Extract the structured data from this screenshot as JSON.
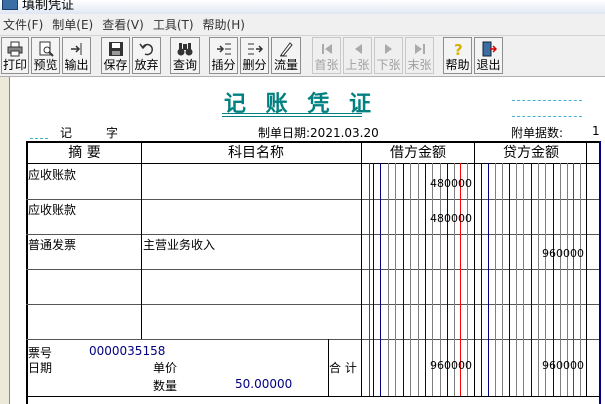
{
  "window": {
    "title": "填制凭证"
  },
  "menu": [
    "文件(F)",
    "制单(E)",
    "查看(V)",
    "工具(T)",
    "帮助(H)"
  ],
  "toolbar": {
    "print": "打印",
    "preview": "预览",
    "export": "输出",
    "save": "保存",
    "discard": "放弃",
    "query": "查询",
    "insert": "插分",
    "delete": "删分",
    "flow": "流量",
    "first": "首张",
    "prev": "上张",
    "next": "下张",
    "last": "末张",
    "help": "帮助",
    "exit": "退出"
  },
  "voucher": {
    "title": "记 账 凭 证",
    "type_label": "记",
    "type_suffix": "字",
    "date_label": "制单日期:2021.03.20",
    "attach_label": "附单据数:",
    "attach_value": "1"
  },
  "headers": {
    "summary": "摘 要",
    "account": "科目名称",
    "debit": "借方金额",
    "credit": "贷方金额"
  },
  "rows": [
    {
      "summary": "应收账款",
      "account": "",
      "debit": "480000",
      "credit": ""
    },
    {
      "summary": "应收账款",
      "account": "",
      "debit": "480000",
      "credit": ""
    },
    {
      "summary": "普通发票",
      "account": "主营业务收入",
      "debit": "",
      "credit": "960000"
    },
    {
      "summary": "",
      "account": "",
      "debit": "",
      "credit": ""
    },
    {
      "summary": "",
      "account": "",
      "debit": "",
      "credit": ""
    }
  ],
  "footer": {
    "ticket_label": "票号",
    "ticket_value": "0000035158",
    "date_label": "日期",
    "price_label": "单价",
    "qty_label": "数量",
    "qty_value": "50.00000",
    "total_label": "合 计",
    "total_debit": "960000",
    "total_credit": "960000"
  }
}
